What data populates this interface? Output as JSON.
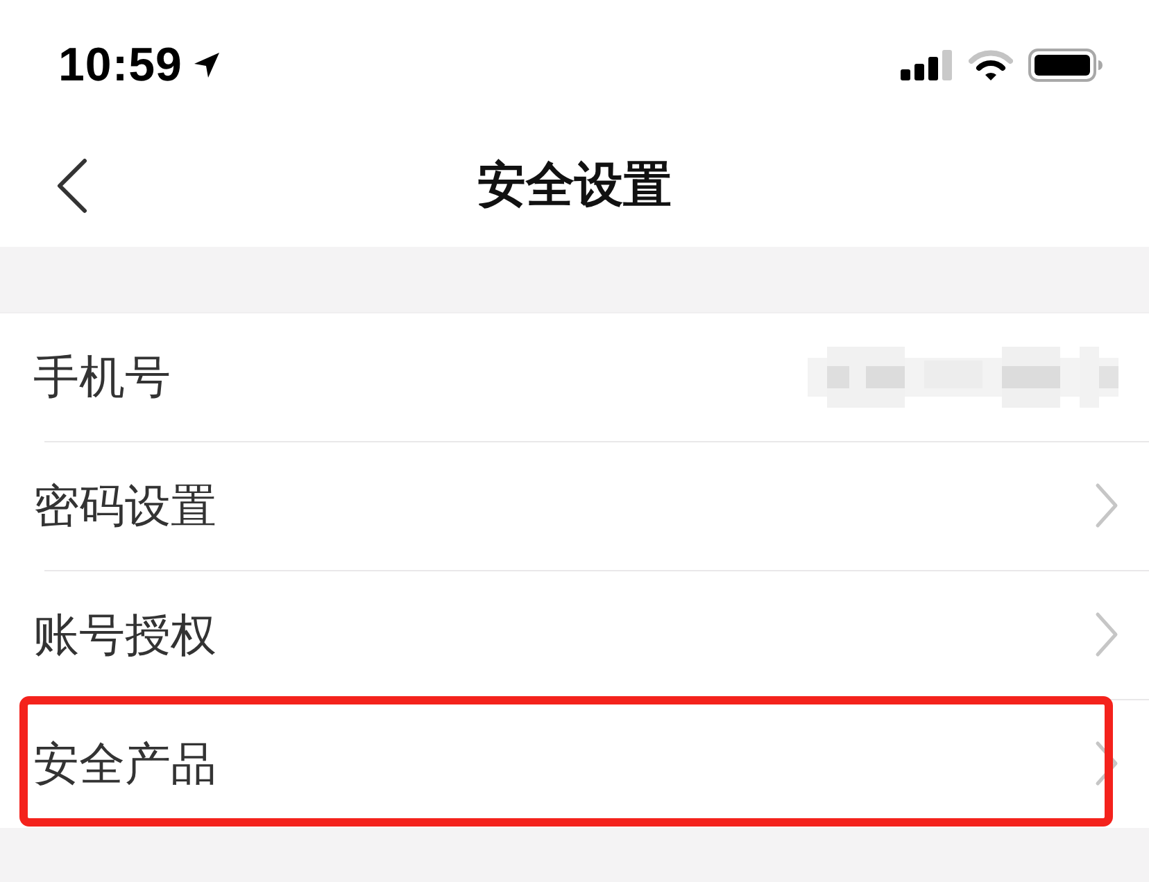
{
  "status_bar": {
    "time": "10:59"
  },
  "nav_bar": {
    "title": "安全设置"
  },
  "rows": [
    {
      "kind": "value",
      "label": "手机号",
      "highlighted": false
    },
    {
      "kind": "link",
      "label": "密码设置",
      "highlighted": false
    },
    {
      "kind": "link",
      "label": "账号授权",
      "highlighted": false
    },
    {
      "kind": "link",
      "label": "安全产品",
      "highlighted": true
    }
  ]
}
